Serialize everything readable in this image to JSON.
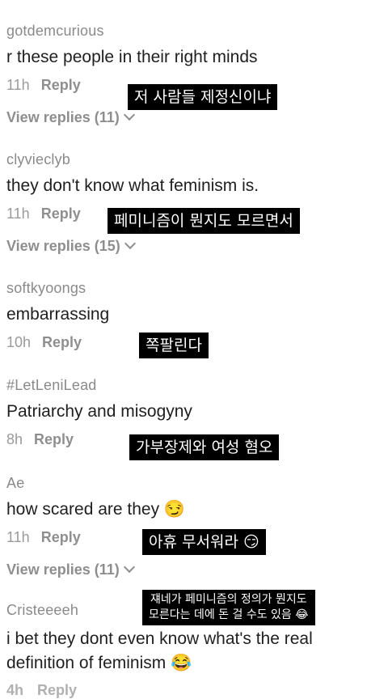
{
  "comments": [
    {
      "username": "gotdemcurious",
      "text": "r these people in their right minds",
      "time": "11h",
      "reply_label": "Reply",
      "view_replies": "View replies (11)",
      "caption": "저 사람들 제정신이냐"
    },
    {
      "username": "clyvieclyb",
      "text": "they don't know what feminism is.",
      "time": "11h",
      "reply_label": "Reply",
      "view_replies": "View replies (15)",
      "caption": "페미니즘이 뭔지도 모르면서"
    },
    {
      "username": "softkyoongs",
      "text": "embarrassing",
      "time": "10h",
      "reply_label": "Reply",
      "caption": "쪽팔린다"
    },
    {
      "username": "#LetLeniLead",
      "text": "Patriarchy and misogyny",
      "time": "8h",
      "reply_label": "Reply",
      "caption": "가부장제와 여성 혐오"
    },
    {
      "username": "Ae",
      "text": "how scared are they 😏",
      "time": "11h",
      "reply_label": "Reply",
      "view_replies": "View replies (11)",
      "caption": "아휴 무서워라 😏"
    },
    {
      "username": "Cristeeeeh",
      "text_line1": "i bet they dont even know what's the real",
      "text_line2": "definition of feminism 😂",
      "time": "4h",
      "reply_label": "Reply",
      "caption_line1": "쟤네가 페미니즘의 정의가 뭔지도",
      "caption_line2": "모른다는 데에 돈 걸 수도 있음 😂"
    }
  ]
}
